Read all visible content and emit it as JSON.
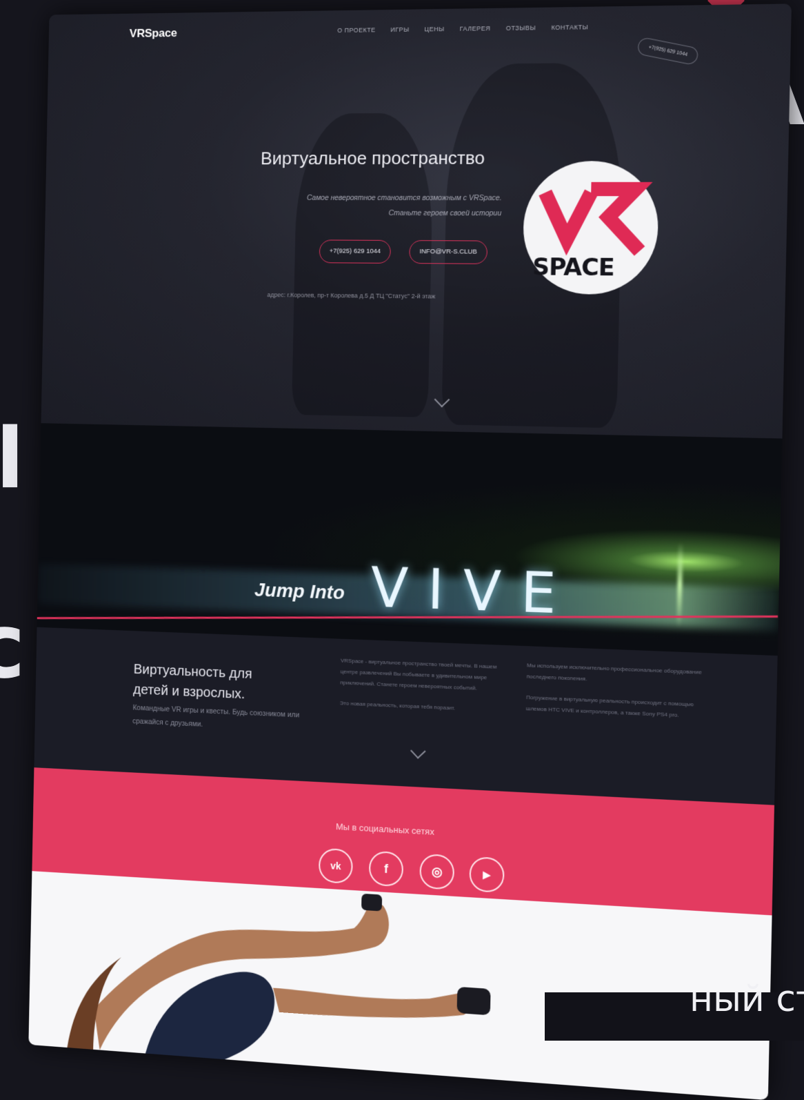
{
  "brand": "VRSpace",
  "nav": {
    "items": [
      "О ПРОЕКТЕ",
      "ИГРЫ",
      "ЦЕНЫ",
      "ГАЛЕРЕЯ",
      "ОТЗЫВЫ",
      "КОНТАКТЫ"
    ],
    "phone": "+7(925) 629 1044"
  },
  "hero": {
    "title": "Виртуальное пространство",
    "subtitle_line1": "Самое невероятное становится возможным с VRSpace.",
    "subtitle_line2": "Станьте героем своей истории",
    "phone_button": "+7(925) 629 1044",
    "email_button": "INFO@VR-S.CLUB",
    "address": "адрес: г.Королев, пр-т Королева д.5 Д ТЦ \"Статус\" 2-й этаж"
  },
  "badge": {
    "top": "VR",
    "bottom": "SPACE"
  },
  "vive": {
    "jump": "Jump Into",
    "word": "VIVE"
  },
  "about": {
    "title_line1": "Виртуальность для",
    "title_line2": "детей и взрослых.",
    "desc": "Командные VR игры и квесты. Будь союзником или сражайся с друзьями.",
    "col2_p1": "VRSpace - виртуальное пространство твоей мечты. В нашем центре развлечений Вы побываете в удивительном мире приключений. Станете героем невероятных событий.",
    "col2_p2": "Это новая реальность, которая тебя поразит.",
    "col3_p1": "Мы используем исключительно профессиональное оборудование последнего поколения.",
    "col3_p2": "Погружение в виртуальную реальность происходит с помощью шлемов HTC VIVE и контроллеров, а также Sony PS4 pro."
  },
  "social": {
    "title": "Мы в социальных сетях",
    "icons": [
      "vk-icon",
      "facebook-icon",
      "instagram-icon",
      "youtube-icon"
    ],
    "vk": "vk",
    "fb": "f",
    "ig": "◎",
    "yt": "▶"
  },
  "overlay_caption": "ный ст",
  "colors": {
    "accent": "#e33b60",
    "dark": "#1b1c26"
  }
}
